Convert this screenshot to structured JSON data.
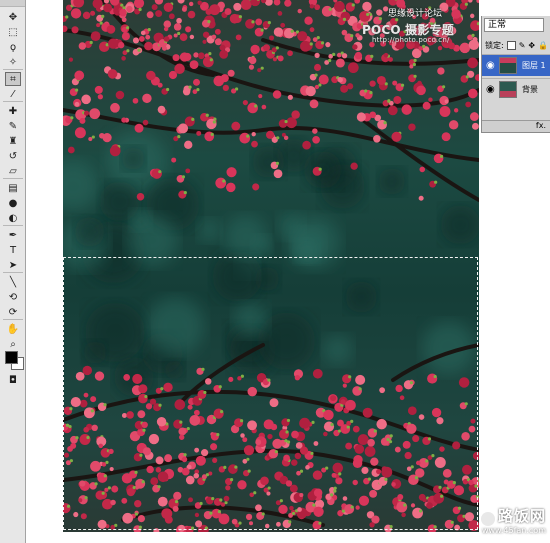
{
  "layers_panel": {
    "blend_mode": "正常",
    "lock_label": "锁定:",
    "layers": [
      {
        "name": "图层 1",
        "selected": true,
        "visible": true
      },
      {
        "name": "背景",
        "selected": false,
        "visible": true
      }
    ],
    "footer": "fx."
  },
  "watermark": {
    "brand": "POCO 摄影专题",
    "url": "http://photo.poco.cn/"
  },
  "corner_text": "思缘设计论坛",
  "site_badge": {
    "name": "路饭网",
    "url": "www.45fan.com"
  },
  "toolbox": {
    "tools": [
      "move-icon",
      "marquee-icon",
      "lasso-icon",
      "magic-wand-icon",
      "crop-icon",
      "eyedropper-icon",
      "healing-brush-icon",
      "brush-icon",
      "clone-stamp-icon",
      "history-brush-icon",
      "eraser-icon",
      "gradient-icon",
      "blur-icon",
      "dodge-icon",
      "pen-icon",
      "type-icon",
      "path-selection-icon",
      "line-icon",
      "3d-rotate-icon",
      "3d-orbit-icon",
      "hand-icon",
      "zoom-icon"
    ],
    "foreground_color": "#000000",
    "background_color": "#ffffff"
  },
  "colors": {
    "blossom": "#d8355a",
    "foliage": "#1c4a42",
    "selection_highlight": "#3766c6"
  }
}
